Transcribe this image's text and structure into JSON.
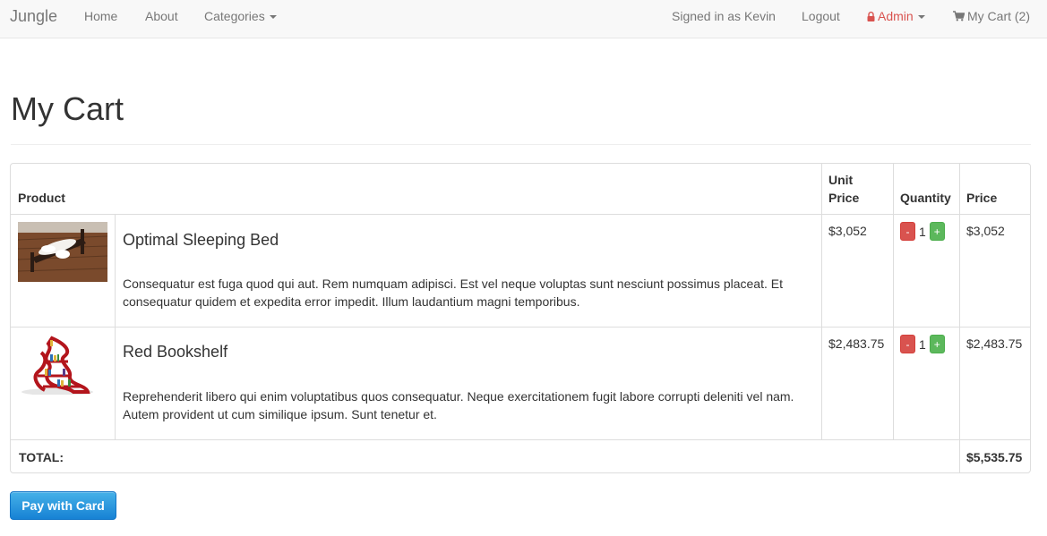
{
  "navbar": {
    "brand": "Jungle",
    "home": "Home",
    "about": "About",
    "categories": "Categories",
    "signed_in": "Signed in as Kevin",
    "logout": "Logout",
    "admin": "Admin",
    "cart": "My Cart (2)",
    "colors": {
      "admin": "#d9534f"
    }
  },
  "page": {
    "title": "My Cart"
  },
  "table": {
    "headers": {
      "product": "Product",
      "unit_price_line1": "Unit",
      "unit_price_line2": "Price",
      "quantity": "Quantity",
      "price": "Price"
    },
    "rows": [
      {
        "name": "Optimal Sleeping Bed",
        "description": "Consequatur est fuga quod qui aut. Rem numquam adipisci. Est vel neque voluptas sunt nesciunt possimus placeat. Et consequatur quidem et expedita error impedit. Illum laudantium magni temporibus.",
        "unit_price": "$3,052",
        "minus": "-",
        "quantity": "1",
        "plus": "+",
        "price": "$3,052"
      },
      {
        "name": "Red Bookshelf",
        "description": "Reprehenderit libero qui enim voluptatibus quos consequatur. Neque exercitationem fugit labore corrupti deleniti vel nam. Autem provident ut cum similique ipsum. Sunt tenetur et.",
        "unit_price": "$2,483.75",
        "minus": "-",
        "quantity": "1",
        "plus": "+",
        "price": "$2,483.75"
      }
    ],
    "total_label": "TOTAL:",
    "total_value": "$5,535.75"
  },
  "pay_button": "Pay with Card",
  "colors": {
    "minus_button": "#d9534f",
    "plus_button": "#5cb85c",
    "pay_button": "#1782d4"
  }
}
